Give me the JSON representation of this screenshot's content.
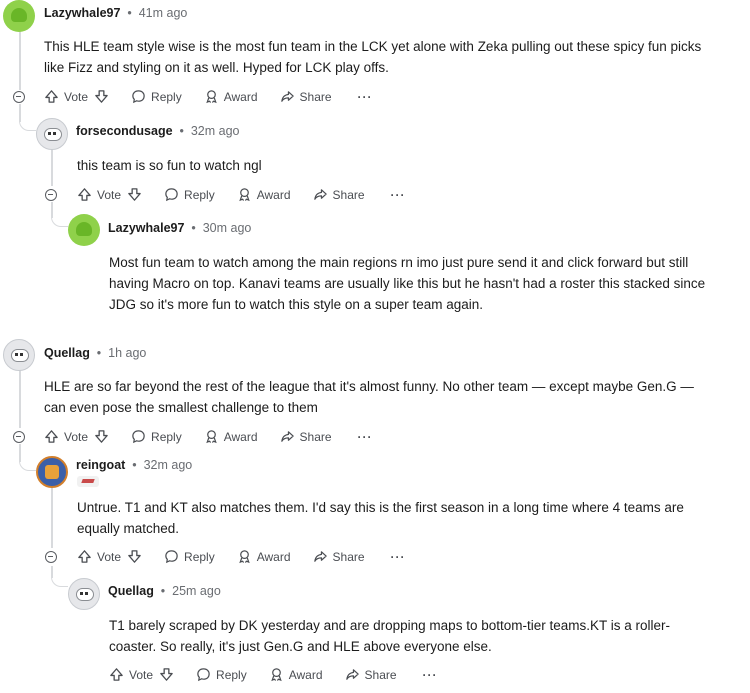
{
  "actions": {
    "vote": "Vote",
    "reply": "Reply",
    "award": "Award",
    "share": "Share",
    "more": "···"
  },
  "comments": [
    {
      "user": "Lazywhale97",
      "time": "41m ago",
      "lines": [
        "This HLE team style wise is the most fun team in the LCK yet alone with Zeka pulling out these spicy fun picks",
        "like Fizz and styling on it as well. Hyped for LCK play offs."
      ]
    },
    {
      "user": "forsecondusage",
      "time": "32m ago",
      "lines": [
        "this team is so fun to watch ngl"
      ]
    },
    {
      "user": "Lazywhale97",
      "time": "30m ago",
      "lines": [
        "Most fun team to watch among the main regions rn imo just pure send it and click forward but still",
        "having Macro on top. Kanavi teams are usually like this but he hasn't had a roster this stacked since",
        "JDG so it's more fun to watch this style on a super team again."
      ]
    },
    {
      "user": "Quellag",
      "time": "1h ago",
      "lines": [
        "HLE are so far beyond the rest of the league that it's almost funny. No other team — except maybe Gen.G —",
        "can even pose the smallest challenge to them"
      ]
    },
    {
      "user": "reingoat",
      "time": "32m ago",
      "lines": [
        "Untrue. T1 and KT also matches them. I'd say this is the first season in a long time where 4 teams are",
        "equally matched."
      ]
    },
    {
      "user": "Quellag",
      "time": "25m ago",
      "lines": [
        "T1 barely scraped by DK yesterday and are dropping maps to bottom-tier teams.KT is a roller-",
        "coaster. So really, it's just Gen.G and HLE above everyone else."
      ]
    }
  ]
}
